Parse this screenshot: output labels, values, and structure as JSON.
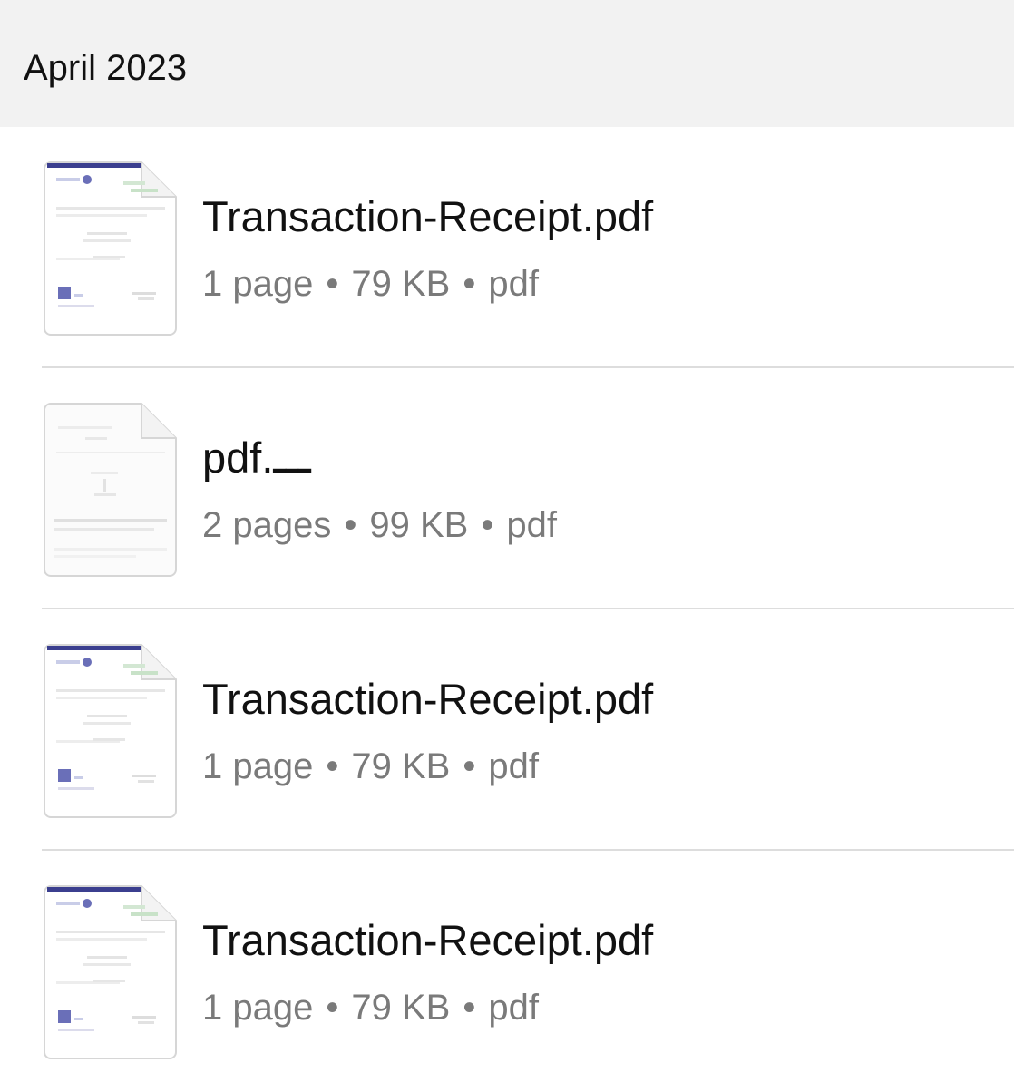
{
  "section": {
    "title": "April 2023"
  },
  "files": [
    {
      "name": "Transaction-Receipt.pdf",
      "pages": "1 page",
      "size": "79 KB",
      "type": "pdf",
      "thumbnail": "receipt-thumbnail"
    },
    {
      "name": "pdf.ـــ",
      "pages": "2 pages",
      "size": "99 KB",
      "type": "pdf",
      "thumbnail": "document-thumbnail"
    },
    {
      "name": "Transaction-Receipt.pdf",
      "pages": "1 page",
      "size": "79 KB",
      "type": "pdf",
      "thumbnail": "receipt-thumbnail"
    },
    {
      "name": "Transaction-Receipt.pdf",
      "pages": "1 page",
      "size": "79 KB",
      "type": "pdf",
      "thumbnail": "receipt-thumbnail"
    }
  ],
  "separator": "•",
  "colors": {
    "header_bg": "#f2f2f2",
    "meta_text": "#7a7a7a",
    "divider": "#dddddd",
    "thumb_accent": "#3b3f8f"
  }
}
